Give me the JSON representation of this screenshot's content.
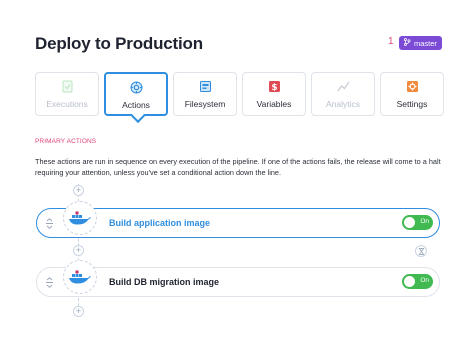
{
  "header": {
    "title": "Deploy to Production",
    "branch_marker": "1",
    "branch_name": "master"
  },
  "tabs": [
    {
      "label": "Executions",
      "icon": "executions-icon",
      "state": "disabled"
    },
    {
      "label": "Actions",
      "icon": "gear-icon",
      "state": "active"
    },
    {
      "label": "Filesystem",
      "icon": "folder-icon",
      "state": "normal"
    },
    {
      "label": "Variables",
      "icon": "dollar-icon",
      "state": "normal"
    },
    {
      "label": "Analytics",
      "icon": "chart-icon",
      "state": "disabled"
    },
    {
      "label": "Settings",
      "icon": "settings-icon",
      "state": "normal"
    }
  ],
  "section": {
    "label": "PRIMARY ACTIONS",
    "description": "These actions are run in sequence on every execution of the pipeline. If one of the actions fails, the release will come to a halt requiring your attention, unless you've set a conditional action down the line."
  },
  "actions": [
    {
      "name": "Build application image",
      "toggle_label": "On",
      "icon": "docker-icon",
      "selected": true
    },
    {
      "name": "Build DB migration image",
      "toggle_label": "On",
      "icon": "docker-icon",
      "selected": false
    }
  ],
  "colors": {
    "accent": "#2f8ee0",
    "toggle_on": "#3fb950",
    "branch_badge": "#7b4bd6",
    "section_label": "#e0457b"
  }
}
